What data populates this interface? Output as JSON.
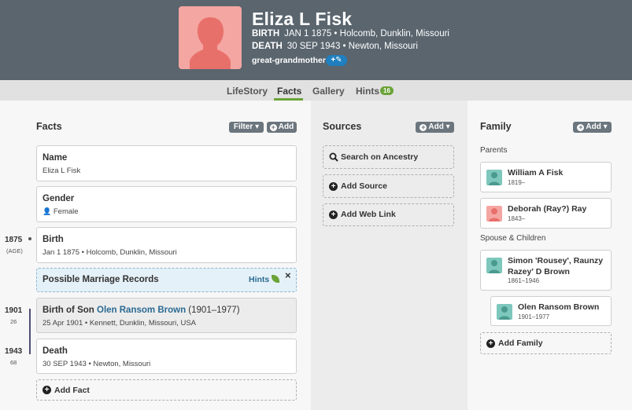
{
  "header": {
    "name": "Eliza L Fisk",
    "birth_label": "BIRTH",
    "birth_value": "JAN 1 1875 • Holcomb, Dunklin, Missouri",
    "death_label": "DEATH",
    "death_value": "30 SEP 1943 • Newton, Missouri",
    "relationship": "great-grandmother",
    "relationship_button_icon": "plus-tag-icon"
  },
  "tabs": [
    {
      "label": "LifeStory"
    },
    {
      "label": "Facts"
    },
    {
      "label": "Gallery"
    },
    {
      "label": "Hints",
      "badge": "16"
    }
  ],
  "facts": {
    "title": "Facts",
    "filter_label": "Filter",
    "add_label": "Add",
    "name_card": {
      "title": "Name",
      "value": "Eliza L Fisk"
    },
    "gender_card": {
      "title": "Gender",
      "value": "Female"
    },
    "birth_card": {
      "title": "Birth",
      "value": "Jan 1 1875 • Holcomb, Dunklin, Missouri",
      "year": "1875",
      "age": "(AGE)"
    },
    "hint_card": {
      "title": "Possible Marriage Records",
      "hints_label": "Hints"
    },
    "son_card": {
      "title_prefix": "Birth of Son ",
      "son_name": "Olen Ransom Brown",
      "title_suffix": " (1901–1977)",
      "value": "25 Apr 1901 • Kennett, Dunklin, Missouri, USA",
      "year": "1901",
      "age": "26"
    },
    "death_card": {
      "title": "Death",
      "value": "30 SEP 1943 • Newton, Missouri",
      "year": "1943",
      "age": "68"
    },
    "add_fact_label": "Add Fact"
  },
  "sources": {
    "title": "Sources",
    "add_label": "Add",
    "search_label": "Search on Ancestry",
    "add_source_label": "Add Source",
    "add_web_link_label": "Add Web Link"
  },
  "family": {
    "title": "Family",
    "add_label": "Add",
    "parents_label": "Parents",
    "father": {
      "name": "William A Fisk",
      "dates": "1819–"
    },
    "mother": {
      "name": "Deborah (Ray?) Ray",
      "dates": "1843–"
    },
    "spouse_children_label": "Spouse & Children",
    "spouse": {
      "name_line1": "Simon 'Rousey', Raunzy",
      "name_line2": "Razey' D Brown",
      "dates": "1861–1946"
    },
    "child": {
      "name": "Olen Ransom Brown",
      "dates": "1901–1977"
    },
    "add_family_label": "Add Family"
  },
  "colors": {
    "header_bg": "#5a656e",
    "accent_green": "#6aa338",
    "female_pink": "#f4a6a2",
    "male_teal": "#7ec7bd",
    "link_blue": "#2a6a93"
  }
}
